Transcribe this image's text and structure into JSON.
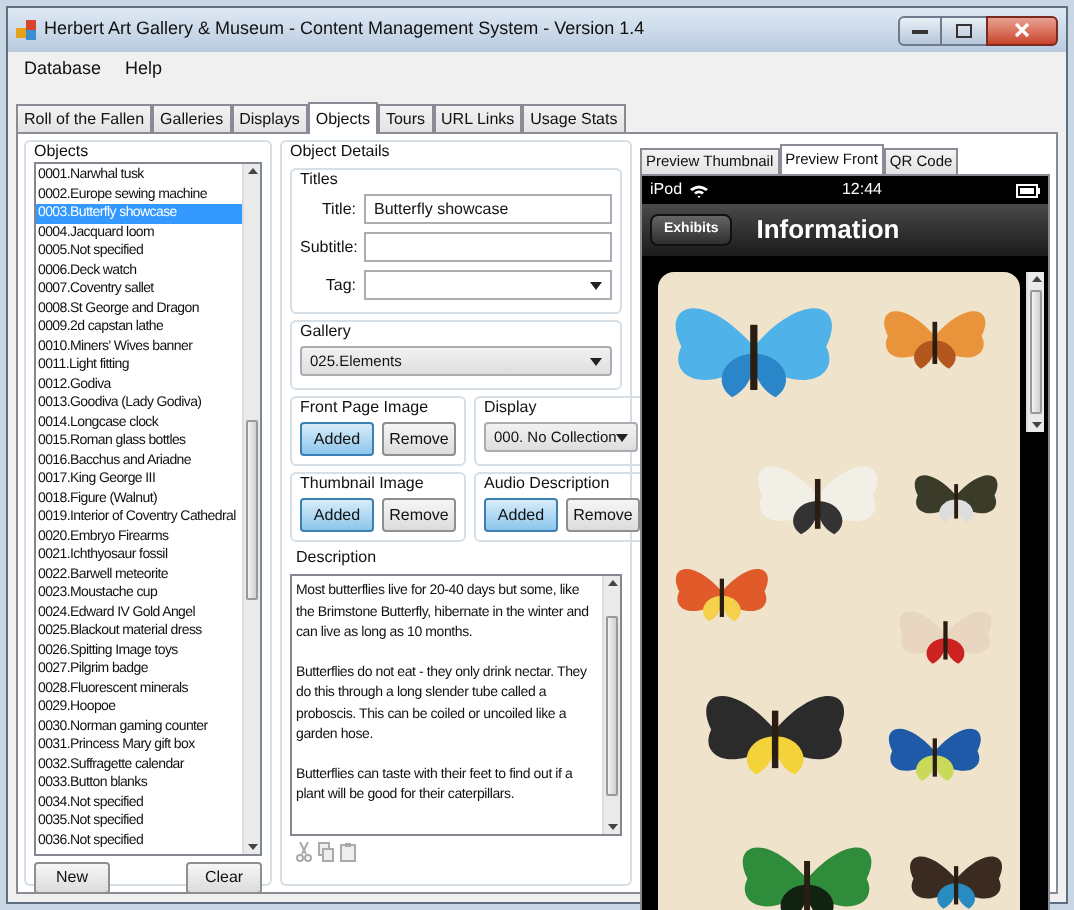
{
  "window": {
    "title": "Herbert Art Gallery & Museum - Content Management System - Version 1.4"
  },
  "menu": [
    "Database",
    "Help"
  ],
  "tabs": [
    {
      "label": "Roll of the Fallen",
      "selected": false
    },
    {
      "label": "Galleries",
      "selected": false
    },
    {
      "label": "Displays",
      "selected": false
    },
    {
      "label": "Objects",
      "selected": true
    },
    {
      "label": "Tours",
      "selected": false
    },
    {
      "label": "URL Links",
      "selected": false
    },
    {
      "label": "Usage Stats",
      "selected": false
    }
  ],
  "objects": {
    "label": "Objects",
    "items": [
      {
        "text": "0001.Narwhal tusk",
        "selected": false
      },
      {
        "text": "0002.Europe sewing machine",
        "selected": false
      },
      {
        "text": "0003.Butterfly showcase",
        "selected": true
      },
      {
        "text": "0004.Jacquard loom",
        "selected": false
      },
      {
        "text": "0005.Not specified",
        "selected": false
      },
      {
        "text": "0006.Deck watch",
        "selected": false
      },
      {
        "text": "0007.Coventry sallet",
        "selected": false
      },
      {
        "text": "0008.St George and Dragon",
        "selected": false
      },
      {
        "text": "0009.2d capstan lathe",
        "selected": false
      },
      {
        "text": "0010.Miners' Wives banner",
        "selected": false
      },
      {
        "text": "0011.Light fitting",
        "selected": false
      },
      {
        "text": "0012.Godiva",
        "selected": false
      },
      {
        "text": "0013.Goodiva (Lady Godiva)",
        "selected": false
      },
      {
        "text": "0014.Longcase clock",
        "selected": false
      },
      {
        "text": "0015.Roman glass bottles",
        "selected": false
      },
      {
        "text": "0016.Bacchus and Ariadne",
        "selected": false
      },
      {
        "text": "0017.King George III",
        "selected": false
      },
      {
        "text": "0018.Figure (Walnut)",
        "selected": false
      },
      {
        "text": "0019.Interior of Coventry Cathedral",
        "selected": false
      },
      {
        "text": "0020.Embryo Firearms",
        "selected": false
      },
      {
        "text": "0021.Ichthyosaur fossil",
        "selected": false
      },
      {
        "text": "0022.Barwell meteorite",
        "selected": false
      },
      {
        "text": "0023.Moustache cup",
        "selected": false
      },
      {
        "text": "0024.Edward IV Gold Angel",
        "selected": false
      },
      {
        "text": "0025.Blackout material dress",
        "selected": false
      },
      {
        "text": "0026.Spitting Image toys",
        "selected": false
      },
      {
        "text": "0027.Pilgrim badge",
        "selected": false
      },
      {
        "text": "0028.Fluorescent minerals",
        "selected": false
      },
      {
        "text": "0029.Hoopoe",
        "selected": false
      },
      {
        "text": "0030.Norman gaming counter",
        "selected": false
      },
      {
        "text": "0031.Princess Mary gift box",
        "selected": false
      },
      {
        "text": "0032.Suffragette calendar",
        "selected": false
      },
      {
        "text": "0033.Button blanks",
        "selected": false
      },
      {
        "text": "0034.Not specified",
        "selected": false
      },
      {
        "text": "0035.Not specified",
        "selected": false
      },
      {
        "text": "0036.Not specified",
        "selected": false
      }
    ],
    "buttons": [
      "New",
      "Clear"
    ]
  },
  "details": {
    "label": "Object Details",
    "titles_label": "Titles",
    "fields": [
      {
        "label": "Title:",
        "value": "Butterfly showcase",
        "kind": "text"
      },
      {
        "label": "Subtitle:",
        "kind": "text"
      },
      {
        "label": "Tag:",
        "kind": "combo"
      }
    ],
    "gallery": {
      "label": "Gallery",
      "value": "025.Elements"
    },
    "front_page_image": {
      "label": "Front Page Image",
      "buttons": [
        {
          "label": "Added",
          "highlighted": true
        },
        {
          "label": "Remove",
          "highlighted": false
        }
      ]
    },
    "display": {
      "label": "Display",
      "value": "000. No Collection"
    },
    "thumbnail_image": {
      "label": "Thumbnail Image",
      "buttons": [
        {
          "label": "Added",
          "highlighted": true
        },
        {
          "label": "Remove",
          "highlighted": false
        }
      ]
    },
    "audio_description": {
      "label": "Audio Description",
      "buttons": [
        {
          "label": "Added",
          "highlighted": true
        },
        {
          "label": "Remove",
          "highlighted": false
        }
      ]
    },
    "description": {
      "label": "Description",
      "paragraphs": [
        "Most butterflies live for 20-40 days but some, like the Brimstone Butterfly, hibernate in the winter and can live as long as 10 months.",
        "Butterflies do not eat - they only drink nectar. They do this through a long slender tube called a proboscis. This can be coiled or uncoiled like a garden hose.",
        "Butterflies can taste with their feet to find out if a plant will be good for their caterpillars."
      ]
    }
  },
  "preview": {
    "tabs": [
      {
        "label": "Preview Thumbnail",
        "selected": false
      },
      {
        "label": "Preview Front",
        "selected": true
      },
      {
        "label": "QR Code",
        "selected": false
      }
    ],
    "device": {
      "carrier": "iPod",
      "time": "12:44",
      "back": "Exhibits",
      "title": "Information"
    }
  }
}
